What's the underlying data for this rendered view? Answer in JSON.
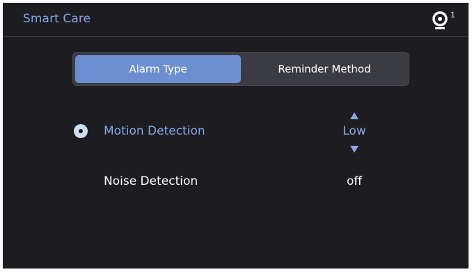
{
  "header": {
    "title": "Smart Care",
    "camera_count": "1",
    "camera_icon": "camera-icon"
  },
  "tabs": [
    {
      "label": "Alarm Type",
      "active": true
    },
    {
      "label": "Reminder Method",
      "active": false
    }
  ],
  "alarm_types": [
    {
      "label": "Motion Detection",
      "selected": true,
      "value": "Low"
    },
    {
      "label": "Noise Detection",
      "selected": false,
      "value": "off"
    }
  ],
  "colors": {
    "background": "#1c1c21",
    "accent": "#86a7e3",
    "active_tab": "#6d8fd2",
    "tab_bar": "#3b3b42",
    "text": "#ffffff"
  }
}
